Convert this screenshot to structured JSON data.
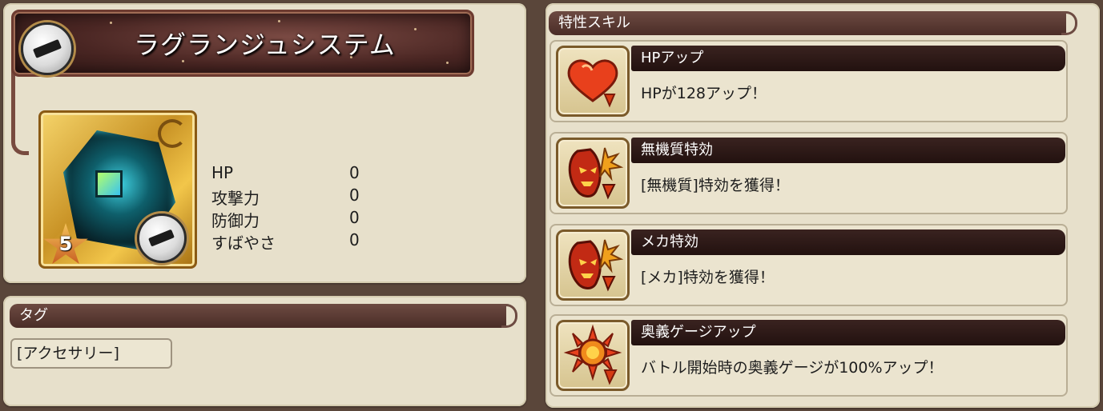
{
  "item": {
    "name": "ラグランジュシステム",
    "rarity": "5",
    "type_icon": "accessory-icon"
  },
  "stats": [
    {
      "label": "HP",
      "value": "0"
    },
    {
      "label": "攻撃力",
      "value": "0"
    },
    {
      "label": "防御力",
      "value": "0"
    },
    {
      "label": "すばやさ",
      "value": "0"
    }
  ],
  "tags": {
    "header": "タグ",
    "items": [
      "[アクセサリー]"
    ]
  },
  "skills": {
    "header": "特性スキル",
    "items": [
      {
        "name": "HPアップ",
        "description": "HPが128アップ！",
        "icon": "heart-up-icon"
      },
      {
        "name": "無機質特効",
        "description": "[無機質]特効を獲得！",
        "icon": "demon-mask-icon"
      },
      {
        "name": "メカ特効",
        "description": "[メカ]特効を獲得！",
        "icon": "demon-mask-icon"
      },
      {
        "name": "奥義ゲージアップ",
        "description": "バトル開始時の奥義ゲージが100%アップ！",
        "icon": "spiked-gauge-icon"
      }
    ]
  },
  "colors": {
    "panel": "#e7e0cb",
    "header": "#4a2d27",
    "gold": "#c99326"
  }
}
